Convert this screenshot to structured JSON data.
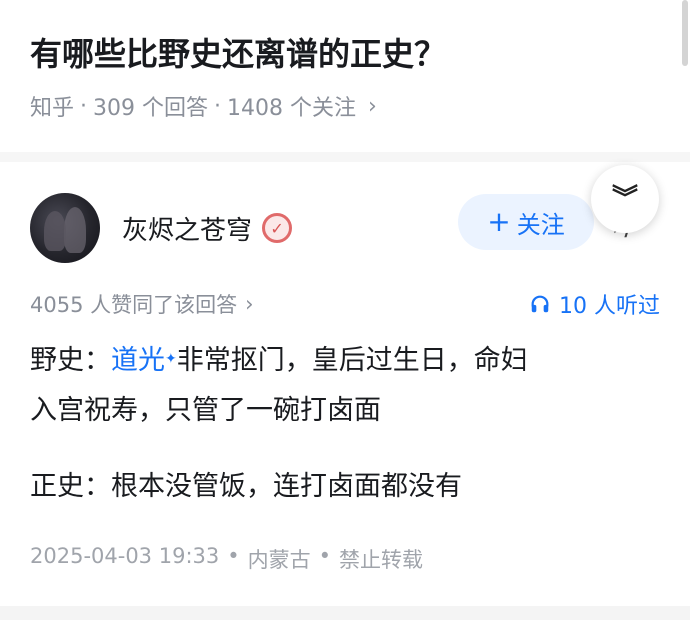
{
  "question": {
    "title": "有哪些比野史还离谱的正史？",
    "source": "知乎",
    "answers_count": "309 个回答",
    "followers_count": "1408 个关注"
  },
  "answer": {
    "author_name": "灰烬之苍穹",
    "follow_label": "关注",
    "upvote_text": "4055 人赞同了该回答",
    "listen_text": "10 人听过",
    "content": {
      "line1_prefix": "野史：",
      "line1_link": "道光",
      "line1_link_mark": "✦",
      "line1_suffix": "非常抠门，皇后过生日，命妇",
      "line2": "入宫祝寿，只管了一碗打卤面",
      "line3": "正史：根本没管饭，连打卤面都没有"
    },
    "date": "2025-04-03 19:33",
    "location": "内蒙古",
    "copyright": "禁止转载"
  },
  "colors": {
    "accent": "#1772f6",
    "meta_gray": "#8a8f99",
    "follow_bg": "#ebf3ff"
  },
  "icons": [
    "chevron-right-icon",
    "double-chevron-down-icon",
    "headphones-icon",
    "verified-badge-icon",
    "avatar"
  ]
}
